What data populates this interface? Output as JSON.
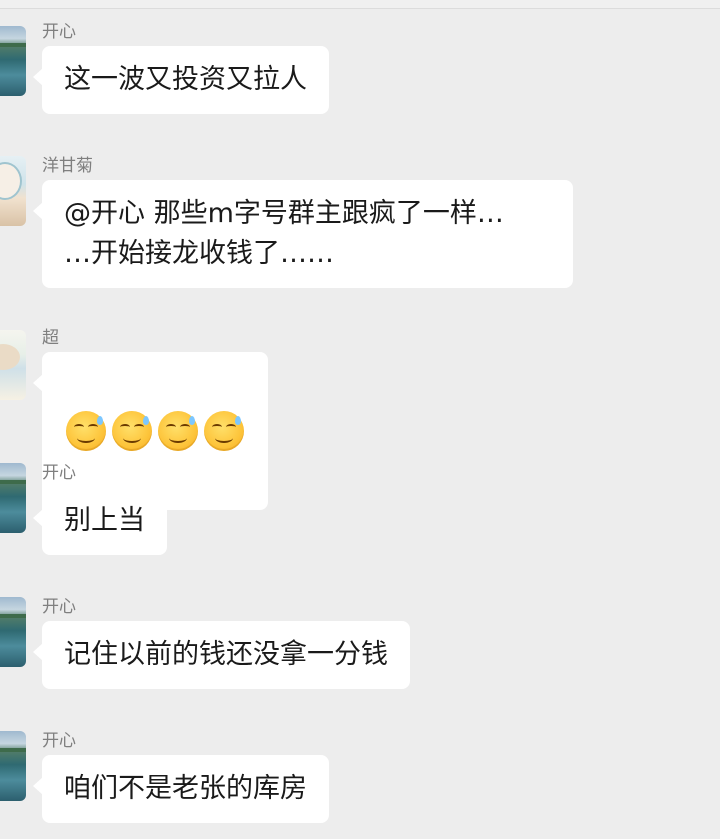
{
  "chat": {
    "messages": [
      {
        "sender": "开心",
        "avatar": "lake-landscape-avatar",
        "text": "这一波又投资又拉人"
      },
      {
        "sender": "洋甘菊",
        "avatar": "cartoon-girl-avatar",
        "text": "@开心 那些m字号群主跟疯了一样…\n…开始接龙收钱了……"
      },
      {
        "sender": "超",
        "avatar": "anime-character-avatar",
        "emojis": [
          "smirk-sweat-emoji",
          "smirk-sweat-emoji",
          "smirk-sweat-emoji",
          "smirk-sweat-emoji"
        ]
      },
      {
        "sender": "开心",
        "avatar": "lake-landscape-avatar",
        "text": "别上当"
      },
      {
        "sender": "开心",
        "avatar": "lake-landscape-avatar",
        "text": "记住以前的钱还没拿一分钱"
      },
      {
        "sender": "开心",
        "avatar": "lake-landscape-avatar",
        "text": "咱们不是老张的库房"
      }
    ]
  },
  "colors": {
    "background": "#ededed",
    "bubble": "#ffffff",
    "name": "#7f7f7f",
    "text": "#1a1a1a"
  }
}
